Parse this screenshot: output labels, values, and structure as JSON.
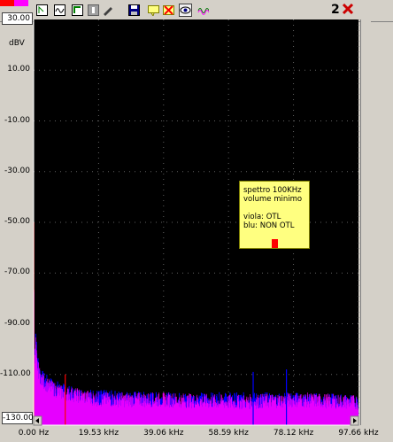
{
  "toolbar": {
    "swatch_colors": [
      "#ff0000",
      "#ff00ff"
    ],
    "buttons": [
      {
        "name": "cursor-icon"
      },
      {
        "name": "scope-icon"
      },
      {
        "name": "zoom-icon"
      },
      {
        "name": "info-icon"
      },
      {
        "name": "pen-icon"
      },
      {
        "name": "save-icon"
      },
      {
        "name": "note-icon"
      },
      {
        "name": "delete-note-icon"
      },
      {
        "name": "eye-icon"
      },
      {
        "name": "wave-icon"
      }
    ],
    "window_number": "2"
  },
  "chart_data": {
    "type": "line",
    "ylabel": "dBV",
    "ylim": [
      -130,
      30
    ],
    "xlim": [
      0,
      97.66
    ],
    "y_ticks": [
      "10.00",
      "-10.00",
      "-30.00",
      "-50.00",
      "-70.00",
      "-90.00",
      "-110.00"
    ],
    "y_tick_values": [
      10,
      -10,
      -30,
      -50,
      -70,
      -90,
      -110
    ],
    "ymax_label": "30.00",
    "ymin_label": "-130.00",
    "x_ticks": [
      "0.00 Hz",
      "19.53 kHz",
      "39.06 kHz",
      "58.59 kHz",
      "78.12 kHz",
      "97.66 kHz"
    ],
    "x_tick_values": [
      0,
      19.53,
      39.06,
      58.59,
      78.12,
      97.66
    ],
    "grid": true,
    "series": [
      {
        "color": "#0000ff",
        "x": [
          0,
          0.3,
          0.6,
          1.0,
          2.0,
          3.0,
          5.0,
          8.0,
          12.0,
          20.0,
          40.0,
          60.0,
          80.0,
          97.66
        ],
        "y": [
          -60,
          -110,
          -96,
          -105,
          -112,
          -114,
          -116,
          -118,
          -120,
          -121,
          -122,
          -122,
          -122,
          -123
        ]
      },
      {
        "color": "#ff00ff",
        "x": [
          0,
          0.3,
          0.6,
          1.0,
          2.0,
          3.0,
          5.0,
          8.0,
          12.0,
          20.0,
          40.0,
          60.0,
          80.0,
          97.66
        ],
        "y": [
          -60,
          -112,
          -100,
          -108,
          -113,
          -115,
          -117,
          -119,
          -120,
          -122,
          -122,
          -123,
          -122,
          -123
        ]
      }
    ],
    "spurs": [
      {
        "color": "#ff0000",
        "x": 0.05,
        "y": -50
      },
      {
        "color": "#ff0000",
        "x": 9.5,
        "y": -110
      },
      {
        "color": "#0000ff",
        "x": 66.0,
        "y": -109
      },
      {
        "color": "#0000ff",
        "x": 76.0,
        "y": -108
      }
    ],
    "colors": {
      "plot_bg": "#000000",
      "grid": "#606060",
      "axis": "#ffffff"
    }
  },
  "note": {
    "lines": [
      "spettro 100KHz",
      "volume minimo",
      "",
      "viola: OTL",
      "blu: NON OTL"
    ],
    "marker_color": "#ff0000"
  }
}
